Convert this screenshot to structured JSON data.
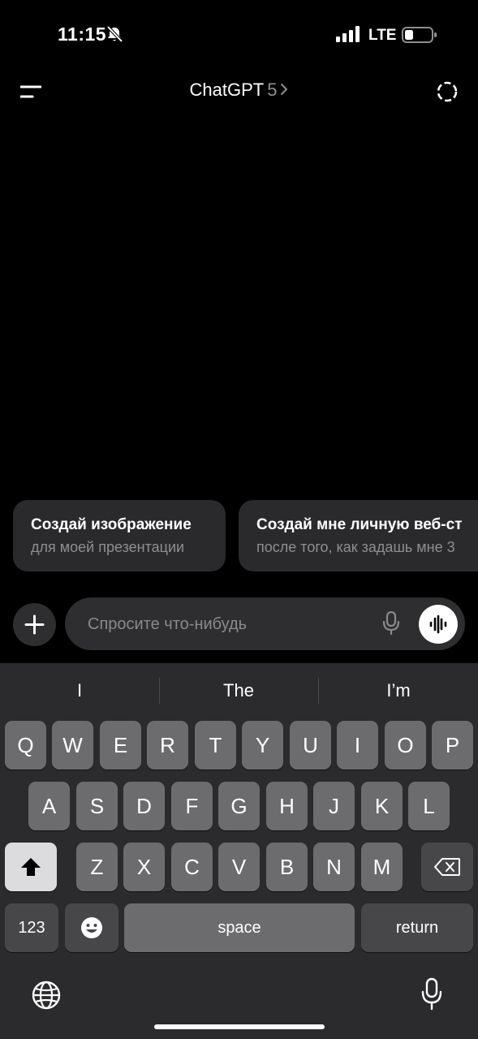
{
  "status_bar": {
    "time": "11:15",
    "network": "LTE",
    "icons": [
      "bell-slash-icon",
      "signal-icon",
      "battery-icon"
    ]
  },
  "header": {
    "title": "ChatGPT",
    "version": "5",
    "icons": [
      "menu-icon",
      "chevron-right-icon",
      "temporary-chat-icon"
    ]
  },
  "suggestions": [
    {
      "title": "Создай изображение",
      "subtitle": "для моей презентации"
    },
    {
      "title": "Создай мне личную веб-ст",
      "subtitle": "после того, как задашь мне 3"
    }
  ],
  "composer": {
    "placeholder": "Спросите что-нибудь",
    "icons": [
      "plus-icon",
      "microphone-icon",
      "voice-waveform-icon"
    ]
  },
  "keyboard": {
    "predictions": [
      "I",
      "The",
      "I’m"
    ],
    "row1": [
      "Q",
      "W",
      "E",
      "R",
      "T",
      "Y",
      "U",
      "I",
      "O",
      "P"
    ],
    "row2": [
      "A",
      "S",
      "D",
      "F",
      "G",
      "H",
      "J",
      "K",
      "L"
    ],
    "row3": [
      "Z",
      "X",
      "C",
      "V",
      "B",
      "N",
      "M"
    ],
    "numbers_label": "123",
    "space_label": "space",
    "return_label": "return",
    "icons": [
      "shift-icon",
      "backspace-icon",
      "emoji-icon",
      "globe-icon",
      "dictation-icon"
    ]
  },
  "colors": {
    "background": "#000000",
    "card": "#2a2a2c",
    "keyboard": "#2b2b2d",
    "key": "#6c6c6e",
    "key_dark": "#474749",
    "secondary_text": "#8e8e93"
  }
}
